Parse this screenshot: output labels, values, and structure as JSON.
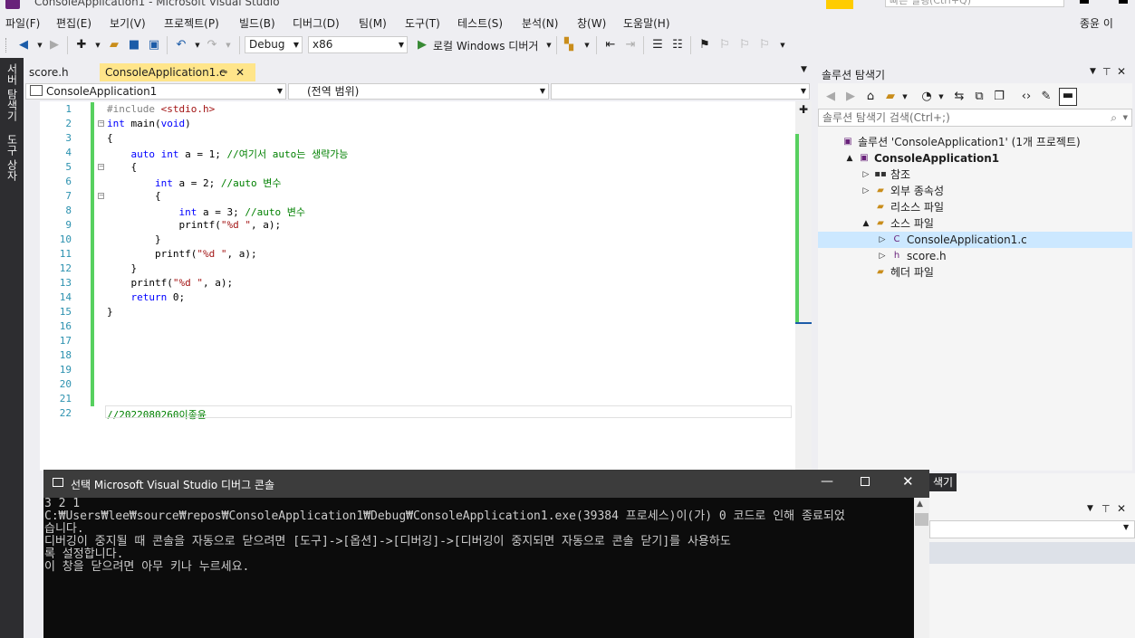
{
  "window": {
    "title": "ConsoleApplication1 - Microsoft Visual Studio",
    "quick_launch_placeholder": "빠른 실행(Ctrl+Q)",
    "user": "종윤 이"
  },
  "menu": [
    "파일(F)",
    "편집(E)",
    "보기(V)",
    "프로젝트(P)",
    "빌드(B)",
    "디버그(D)",
    "팀(M)",
    "도구(T)",
    "테스트(S)",
    "분석(N)",
    "창(W)",
    "도움말(H)"
  ],
  "toolbar": {
    "config": "Debug",
    "platform": "x86",
    "run_label": "로컬 Windows 디버거"
  },
  "left_strip": [
    "서버 탐색기",
    "도구 상자"
  ],
  "tabs": [
    {
      "label": "score.h",
      "active": false
    },
    {
      "label": "ConsoleApplication1.c",
      "active": true
    }
  ],
  "nav": {
    "project": "ConsoleApplication1",
    "scope": "(전역 범위)",
    "member": ""
  },
  "code": {
    "line_numbers": [
      "1",
      "2",
      "3",
      "4",
      "5",
      "6",
      "7",
      "8",
      "9",
      "10",
      "11",
      "12",
      "13",
      "14",
      "15",
      "16",
      "17",
      "18",
      "19",
      "20",
      "21",
      "22"
    ],
    "lines": [
      {
        "indent": "",
        "parts": [
          {
            "t": "#include ",
            "c": "pp"
          },
          {
            "t": "<stdio.h>",
            "c": "inc"
          }
        ]
      },
      {
        "indent": "",
        "parts": [
          {
            "t": "int",
            "c": "kw"
          },
          {
            "t": " main(",
            "c": ""
          },
          {
            "t": "void",
            "c": "kw"
          },
          {
            "t": ")",
            "c": ""
          }
        ]
      },
      {
        "indent": "",
        "parts": [
          {
            "t": "{",
            "c": ""
          }
        ]
      },
      {
        "indent": "    ",
        "parts": [
          {
            "t": "auto",
            "c": "kw"
          },
          {
            "t": " ",
            "c": ""
          },
          {
            "t": "int",
            "c": "kw"
          },
          {
            "t": " a = 1; ",
            "c": ""
          },
          {
            "t": "//여기서 auto는 생략가능",
            "c": "cm"
          }
        ]
      },
      {
        "indent": "    ",
        "parts": [
          {
            "t": "{",
            "c": ""
          }
        ]
      },
      {
        "indent": "        ",
        "parts": [
          {
            "t": "int",
            "c": "kw"
          },
          {
            "t": " a = 2; ",
            "c": ""
          },
          {
            "t": "//auto 변수",
            "c": "cm"
          }
        ]
      },
      {
        "indent": "        ",
        "parts": [
          {
            "t": "{",
            "c": ""
          }
        ]
      },
      {
        "indent": "            ",
        "parts": [
          {
            "t": "int",
            "c": "kw"
          },
          {
            "t": " a = 3; ",
            "c": ""
          },
          {
            "t": "//auto 변수",
            "c": "cm"
          }
        ]
      },
      {
        "indent": "            ",
        "parts": [
          {
            "t": "printf(",
            "c": ""
          },
          {
            "t": "\"%d \"",
            "c": "str"
          },
          {
            "t": ", a);",
            "c": ""
          }
        ]
      },
      {
        "indent": "        ",
        "parts": [
          {
            "t": "}",
            "c": ""
          }
        ]
      },
      {
        "indent": "        ",
        "parts": [
          {
            "t": "printf(",
            "c": ""
          },
          {
            "t": "\"%d \"",
            "c": "str"
          },
          {
            "t": ", a);",
            "c": ""
          }
        ]
      },
      {
        "indent": "    ",
        "parts": [
          {
            "t": "}",
            "c": ""
          }
        ]
      },
      {
        "indent": "    ",
        "parts": [
          {
            "t": "printf(",
            "c": ""
          },
          {
            "t": "\"%d \"",
            "c": "str"
          },
          {
            "t": ", a);",
            "c": ""
          }
        ]
      },
      {
        "indent": "    ",
        "parts": [
          {
            "t": "return",
            "c": "kw"
          },
          {
            "t": " 0;",
            "c": ""
          }
        ]
      },
      {
        "indent": "",
        "parts": [
          {
            "t": "}",
            "c": ""
          }
        ]
      },
      {
        "indent": "",
        "parts": []
      },
      {
        "indent": "",
        "parts": []
      },
      {
        "indent": "",
        "parts": []
      },
      {
        "indent": "",
        "parts": []
      },
      {
        "indent": "",
        "parts": []
      },
      {
        "indent": "",
        "parts": []
      },
      {
        "indent": "",
        "parts": [
          {
            "t": "//2022080260이종윤",
            "c": "cm"
          }
        ]
      }
    ]
  },
  "solution_explorer": {
    "title": "솔루션 탐색기",
    "search_placeholder": "솔루션 탐색기 검색(Ctrl+;)",
    "tree": [
      {
        "label": "솔루션 'ConsoleApplication1' (1개 프로젝트)",
        "level": 0,
        "expander": "",
        "icon": "solution-icon",
        "bold": false,
        "selected": false
      },
      {
        "label": "ConsoleApplication1",
        "level": 1,
        "expander": "▲",
        "icon": "project-icon",
        "bold": true,
        "selected": false
      },
      {
        "label": "참조",
        "level": 2,
        "expander": "▷",
        "icon": "references-icon",
        "bold": false,
        "selected": false
      },
      {
        "label": "외부 종속성",
        "level": 2,
        "expander": "▷",
        "icon": "folder-icon",
        "bold": false,
        "selected": false
      },
      {
        "label": "리소스 파일",
        "level": 2,
        "expander": "",
        "icon": "folder-icon",
        "bold": false,
        "selected": false
      },
      {
        "label": "소스 파일",
        "level": 2,
        "expander": "▲",
        "icon": "folder-icon",
        "bold": false,
        "selected": false
      },
      {
        "label": "ConsoleApplication1.c",
        "level": 3,
        "expander": "▷",
        "icon": "c-file-icon",
        "bold": false,
        "selected": true
      },
      {
        "label": "score.h",
        "level": 3,
        "expander": "▷",
        "icon": "h-file-icon",
        "bold": false,
        "selected": false
      },
      {
        "label": "헤더 파일",
        "level": 2,
        "expander": "",
        "icon": "folder-icon",
        "bold": false,
        "selected": false
      }
    ],
    "hidden_tab": "색기"
  },
  "console": {
    "title": "선택 Microsoft Visual Studio 디버그 콘솔",
    "lines": [
      "3 2 1",
      "C:₩Users₩lee₩source₩repos₩ConsoleApplication1₩Debug₩ConsoleApplication1.exe(39384 프로세스)이(가) 0 코드로 인해 종료되었",
      "습니다.",
      "디버깅이 중지될 때 콘솔을 자동으로 닫으려면 [도구]->[옵션]->[디버깅]->[디버깅이 중지되면 자동으로 콘솔 닫기]를 사용하도",
      "록 설정합니다.",
      "이 창을 닫으려면 아무 키나 누르세요."
    ]
  }
}
